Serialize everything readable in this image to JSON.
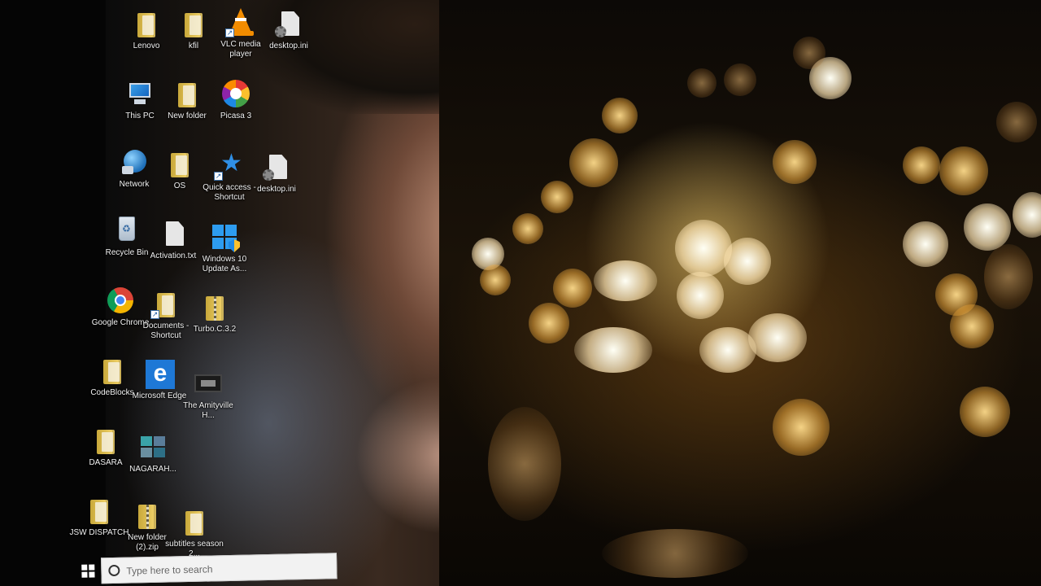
{
  "desktop": {
    "icons": [
      {
        "label": "Lenovo",
        "icon": "folder-icon"
      },
      {
        "label": "kfil",
        "icon": "folder-icon"
      },
      {
        "label": "VLC media player",
        "icon": "vlc-icon"
      },
      {
        "label": "desktop.ini",
        "icon": "settings-file-icon"
      },
      {
        "label": "This PC",
        "icon": "computer-icon"
      },
      {
        "label": "New folder",
        "icon": "folder-icon"
      },
      {
        "label": "Picasa 3",
        "icon": "picasa-icon"
      },
      {
        "label": "Network",
        "icon": "network-icon"
      },
      {
        "label": "OS",
        "icon": "folder-icon"
      },
      {
        "label": "Quick access - Shortcut",
        "icon": "star-icon"
      },
      {
        "label": "desktop.ini",
        "icon": "settings-file-icon"
      },
      {
        "label": "Recycle Bin",
        "icon": "recycle-bin-icon"
      },
      {
        "label": "Activation.txt",
        "icon": "text-file-icon"
      },
      {
        "label": "Windows 10 Update As...",
        "icon": "windows-update-icon"
      },
      {
        "label": "Google Chrome",
        "icon": "chrome-icon"
      },
      {
        "label": "Documents - Shortcut",
        "icon": "folder-shortcut-icon"
      },
      {
        "label": "Turbo.C.3.2",
        "icon": "zip-folder-icon"
      },
      {
        "label": "CodeBlocks",
        "icon": "folder-icon"
      },
      {
        "label": "Microsoft Edge",
        "icon": "edge-icon"
      },
      {
        "label": "The Amityville H...",
        "icon": "video-file-icon"
      },
      {
        "label": "DASARA",
        "icon": "folder-icon"
      },
      {
        "label": "NAGARAH...",
        "icon": "image-folder-icon"
      },
      {
        "label": "JSW DISPATCH",
        "icon": "folder-icon"
      },
      {
        "label": "New folder (2).zip",
        "icon": "zip-folder-icon"
      },
      {
        "label": "subtitles season 2...",
        "icon": "folder-icon"
      }
    ]
  },
  "taskbar": {
    "search_placeholder": "Type here to search"
  }
}
